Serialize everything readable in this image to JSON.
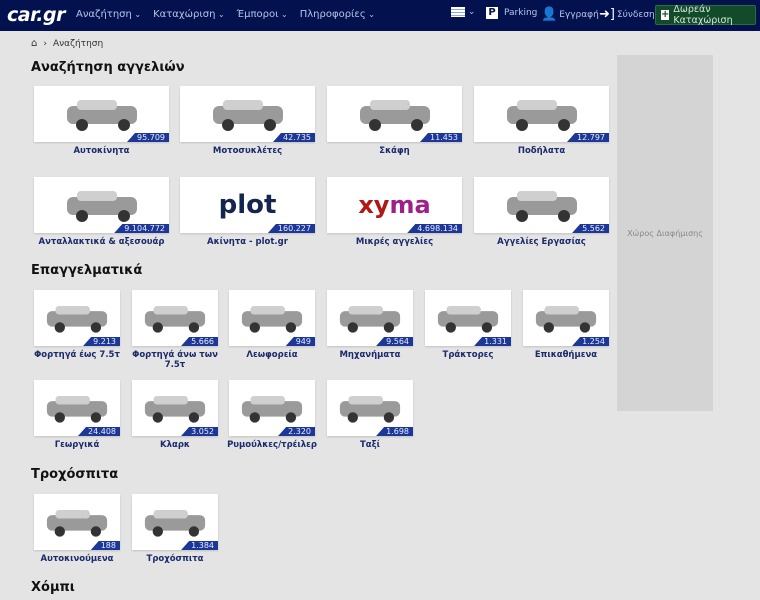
{
  "nav": {
    "logo": "car.gr",
    "menu": [
      "Αναζήτηση",
      "Καταχώριση",
      "Έμποροι",
      "Πληροφορίες"
    ],
    "parking": "Parking",
    "register": "Εγγραφή",
    "login": "Σύνδεση",
    "cta": "Δωρεάν Καταχώριση"
  },
  "breadcrumb": {
    "current": "Αναζήτηση"
  },
  "sections": {
    "search": "Αναζήτηση αγγελιών",
    "pro": "Επαγγελματικά",
    "caravans": "Τροχόσπιτα",
    "hobby": "Χόμπι"
  },
  "search_items": [
    {
      "label": "Αυτοκίνητα",
      "count": "95.709"
    },
    {
      "label": "Μοτοσυκλέτες",
      "count": "42.735"
    },
    {
      "label": "Σκάφη",
      "count": "11.453"
    },
    {
      "label": "Ποδήλατα",
      "count": "12.797"
    },
    {
      "label": "Ανταλλακτικά & αξεσουάρ",
      "count": "9.104.772"
    },
    {
      "label": "Ακίνητα - plot.gr",
      "count": "160.227",
      "logo": "plot"
    },
    {
      "label": "Μικρές αγγελίες",
      "count": "4.698.134",
      "logo": "xyma shop"
    },
    {
      "label": "Αγγελίες Εργασίας",
      "count": "5.562"
    }
  ],
  "pro_items": [
    {
      "label": "Φορτηγά έως 7.5τ",
      "count": "9.213"
    },
    {
      "label": "Φορτηγά άνω των 7.5τ",
      "count": "5.666"
    },
    {
      "label": "Λεωφορεία",
      "count": "949"
    },
    {
      "label": "Μηχανήματα",
      "count": "9.564"
    },
    {
      "label": "Τράκτορες",
      "count": "1.331"
    },
    {
      "label": "Επικαθήμενα",
      "count": "1.254"
    },
    {
      "label": "Γεωργικά",
      "count": "24.408"
    },
    {
      "label": "Κλαρκ",
      "count": "3.052"
    },
    {
      "label": "Ρυμούλκες/τρέιλερ",
      "count": "2.320"
    },
    {
      "label": "Ταξί",
      "count": "1.698"
    }
  ],
  "caravan_items": [
    {
      "label": "Αυτοκινούμενα",
      "count": "188"
    },
    {
      "label": "Τροχόσπιτα",
      "count": "1.384"
    }
  ],
  "ad": {
    "label": "Χώρος Διαφήμισης"
  }
}
